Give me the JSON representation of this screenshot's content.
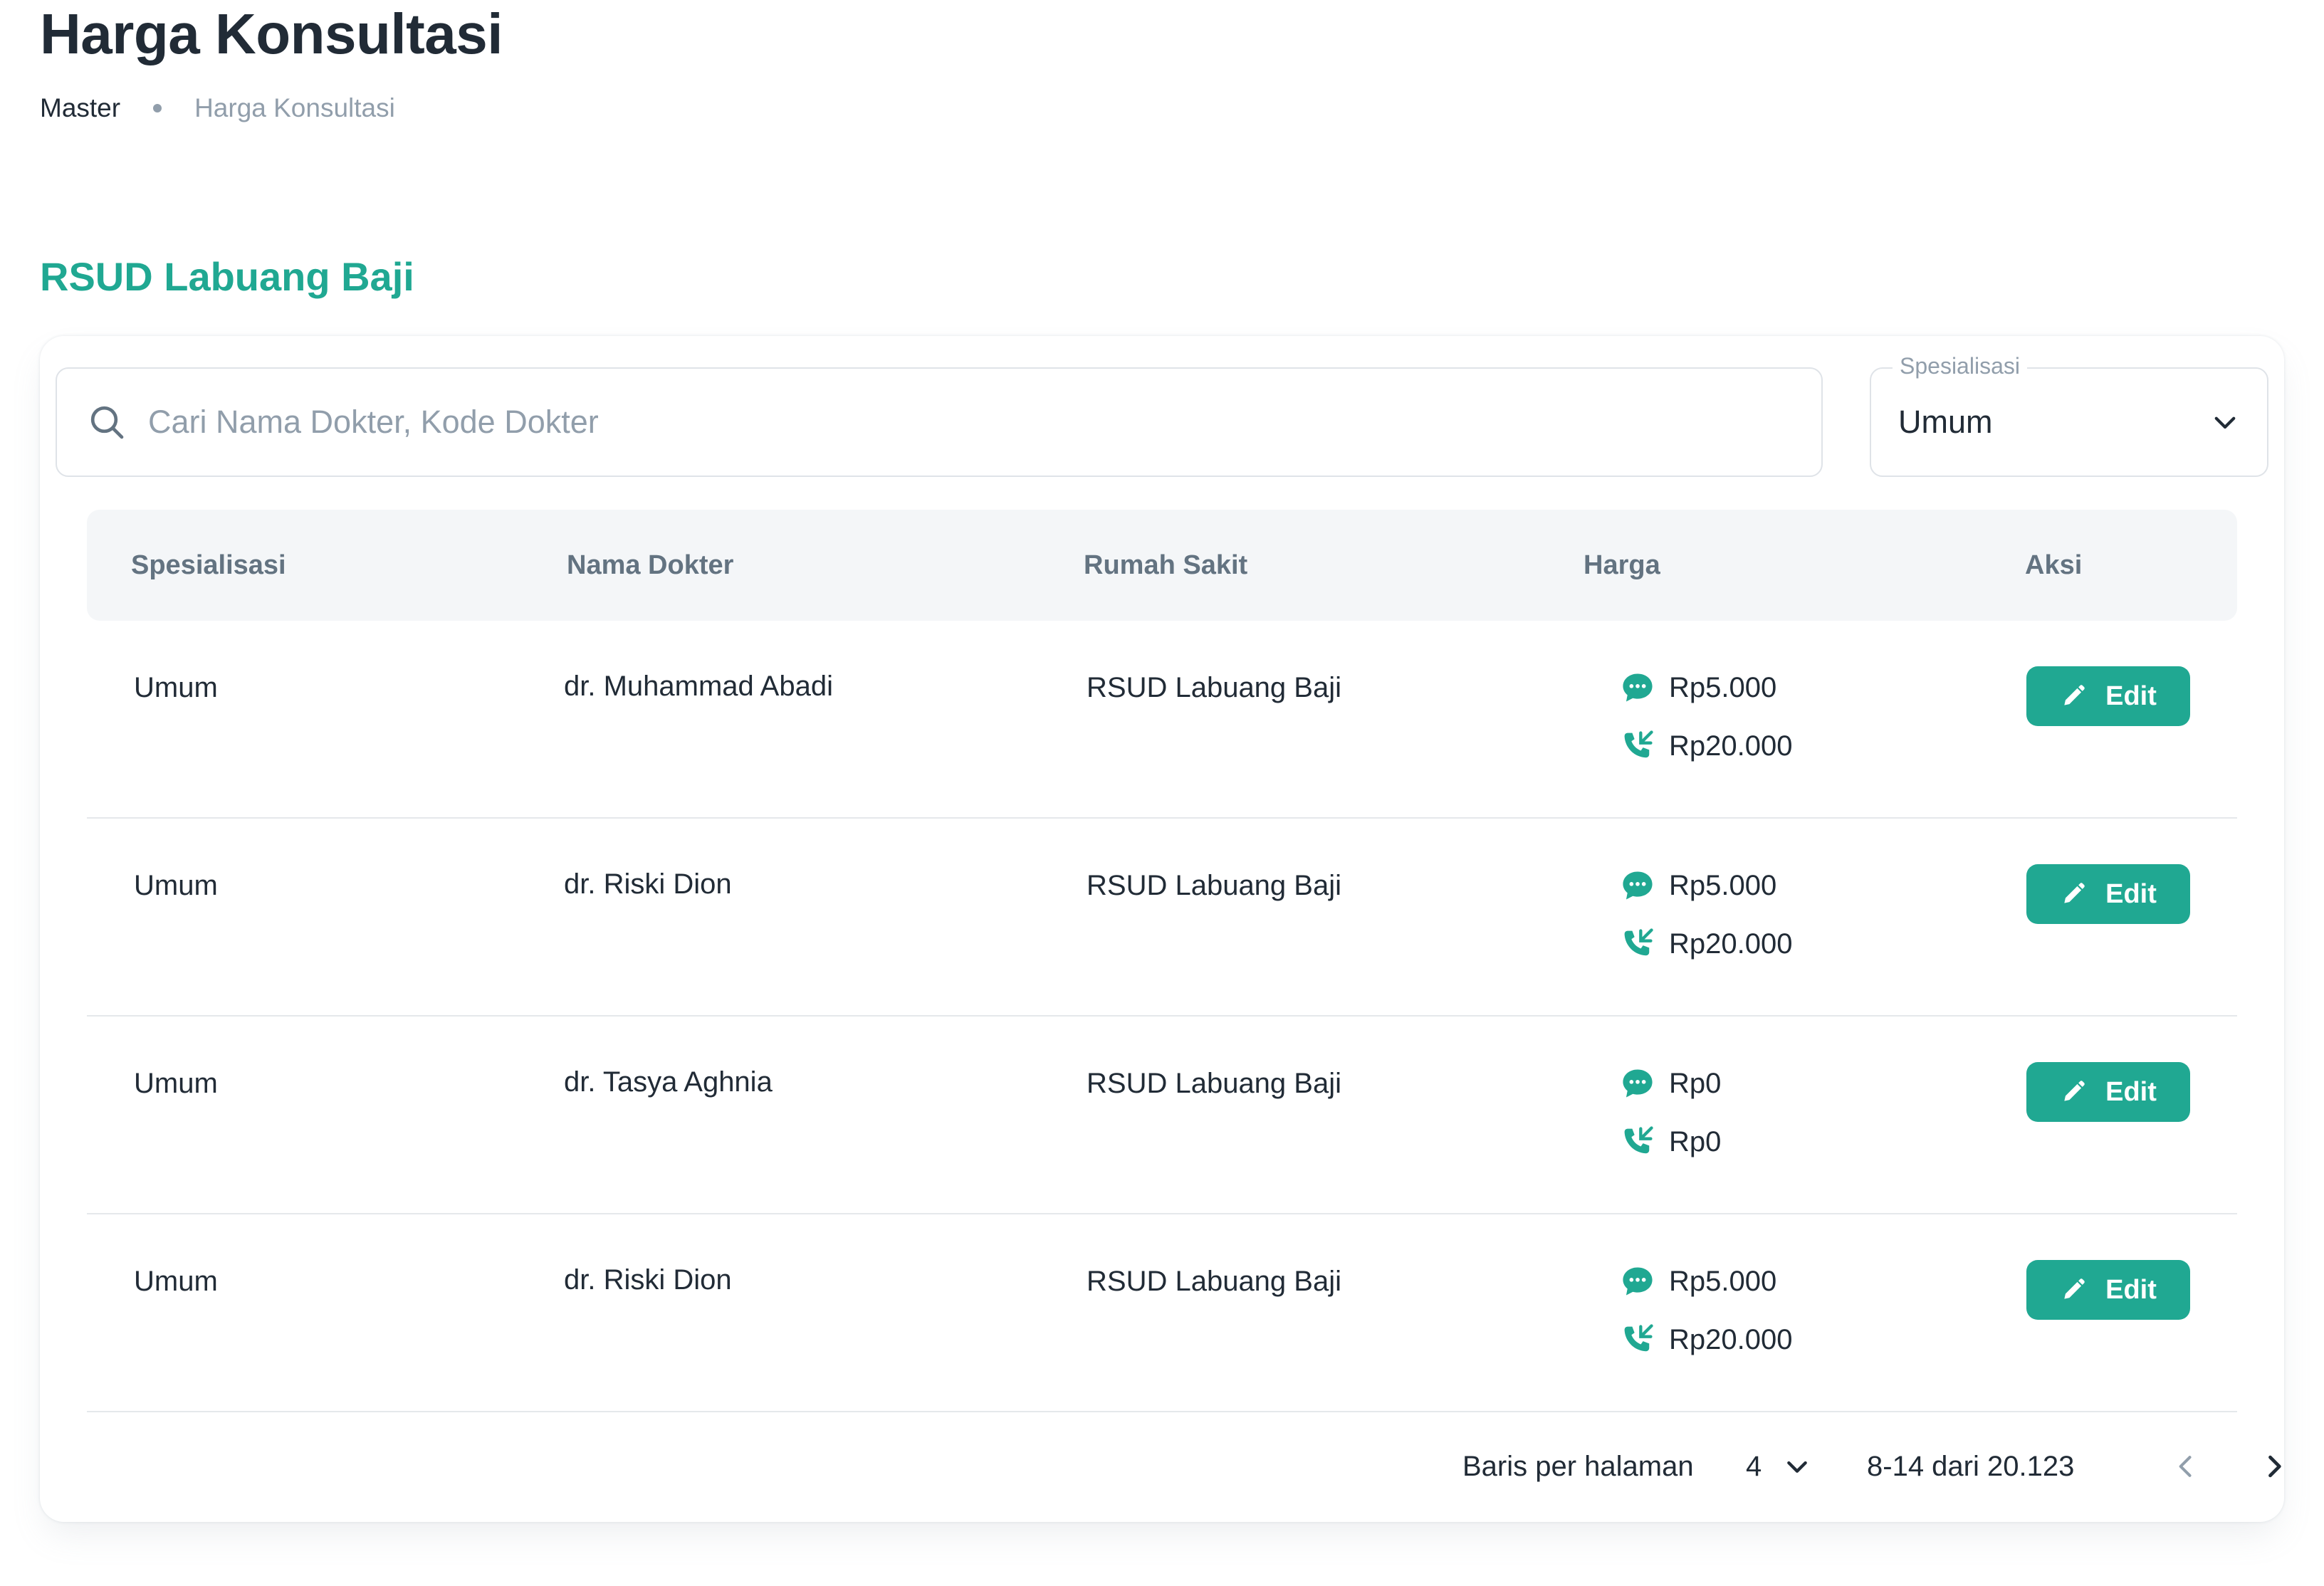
{
  "page": {
    "title": "Harga Konsultasi",
    "breadcrumb": [
      "Master",
      "Harga Konsultasi"
    ],
    "hospital": "RSUD Labuang Baji"
  },
  "colors": {
    "accent": "#20a892",
    "text": "#212b36",
    "muted": "#919eab",
    "header_bg": "#f4f6f8"
  },
  "search": {
    "placeholder": "Cari Nama Dokter, Kode Dokter",
    "value": "",
    "icon": "search-icon"
  },
  "filter": {
    "label": "Spesialisasi",
    "value": "Umum",
    "icon": "chevron-down-icon"
  },
  "table": {
    "headers": [
      "Spesialisasi",
      "Nama Dokter",
      "Rumah Sakit",
      "Harga",
      "Aksi"
    ],
    "rows": [
      {
        "specialization": "Umum",
        "doctor": "dr. Muhammad Abadi",
        "hospital": "RSUD Labuang Baji",
        "chat_price": "Rp5.000",
        "call_price": "Rp20.000",
        "action": "Edit"
      },
      {
        "specialization": "Umum",
        "doctor": "dr. Riski Dion",
        "hospital": "RSUD Labuang Baji",
        "chat_price": "Rp5.000",
        "call_price": "Rp20.000",
        "action": "Edit"
      },
      {
        "specialization": "Umum",
        "doctor": "dr. Tasya Aghnia",
        "hospital": "RSUD Labuang Baji",
        "chat_price": "Rp0",
        "call_price": "Rp0",
        "action": "Edit"
      },
      {
        "specialization": "Umum",
        "doctor": "dr. Riski Dion",
        "hospital": "RSUD Labuang Baji",
        "chat_price": "Rp5.000",
        "call_price": "Rp20.000",
        "action": "Edit"
      }
    ],
    "icons": {
      "chat": "chat-bubble-icon",
      "call": "phone-call-icon",
      "edit": "pencil-icon"
    }
  },
  "pagination": {
    "rows_label": "Baris per halaman",
    "rows_value": "4",
    "range": "8-14 dari 20.123",
    "prev_icon": "chevron-left-icon",
    "next_icon": "chevron-right-icon"
  }
}
